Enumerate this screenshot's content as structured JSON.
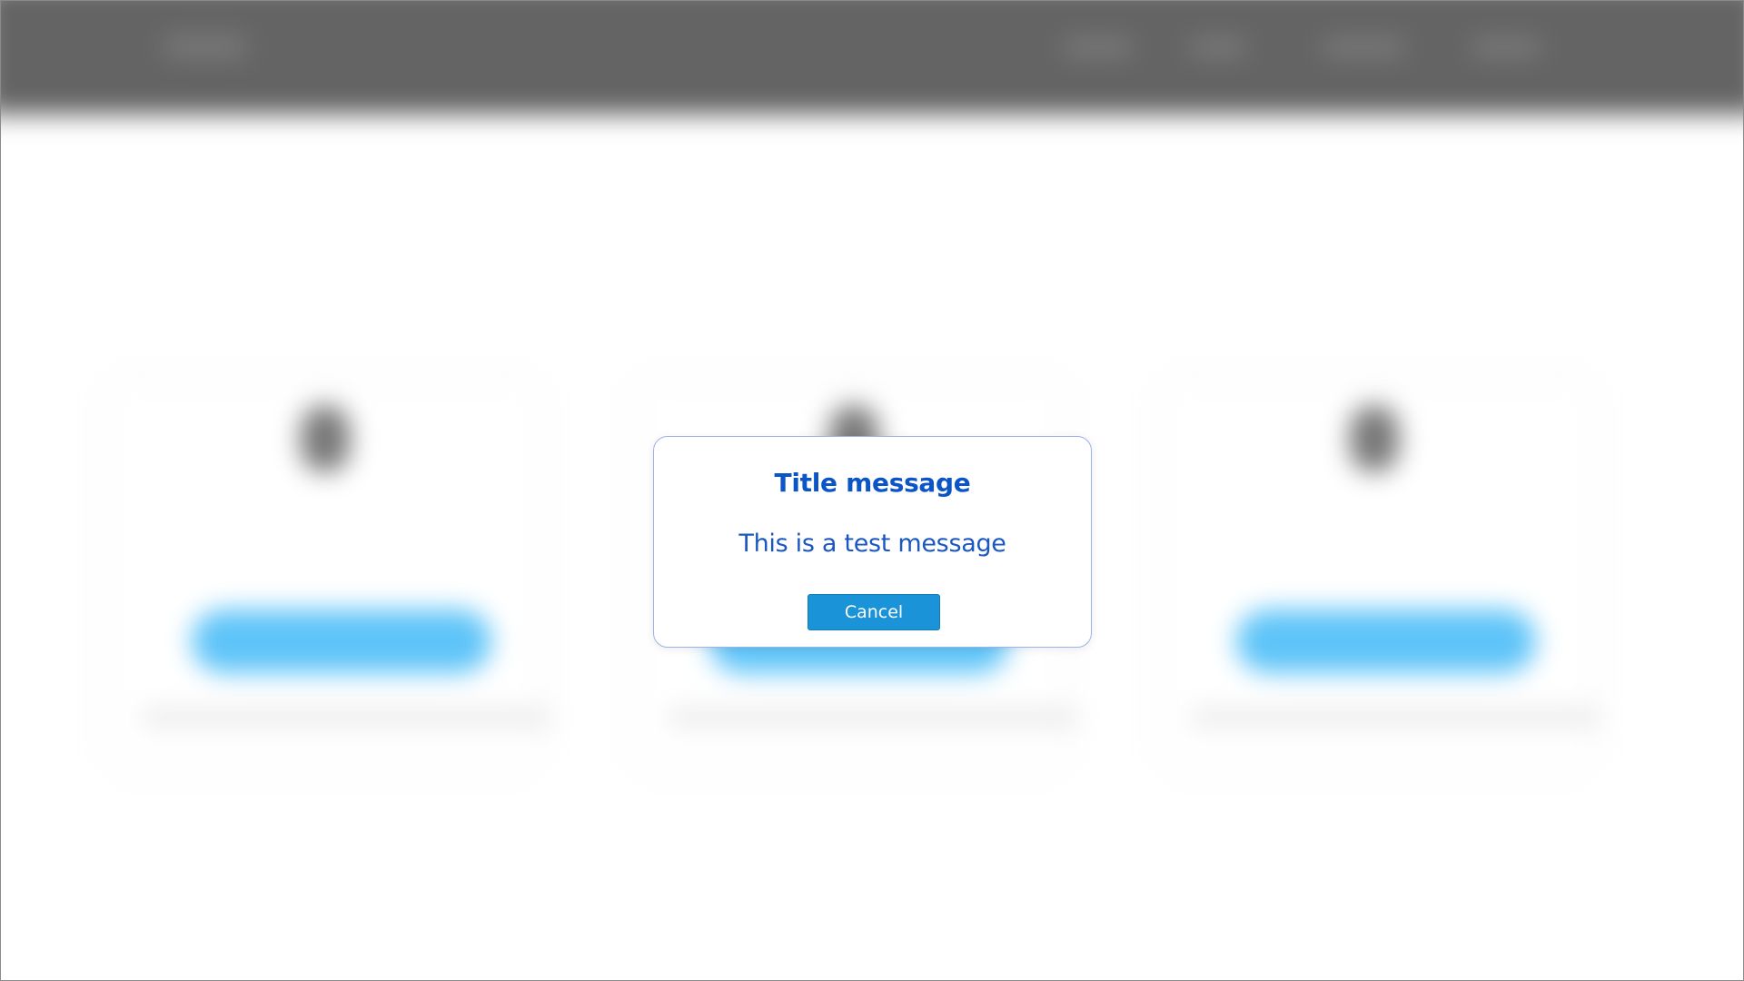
{
  "dialog": {
    "title": "Title message",
    "message": "This is a test message",
    "cancel_label": "Cancel"
  },
  "colors": {
    "title": "#0b55c7",
    "message": "#1b57c2",
    "button_bg": "#1a93d9",
    "modal_border": "#9db3e6",
    "header_bg": "#646464",
    "card_button_bg": "#5ec4f8"
  }
}
